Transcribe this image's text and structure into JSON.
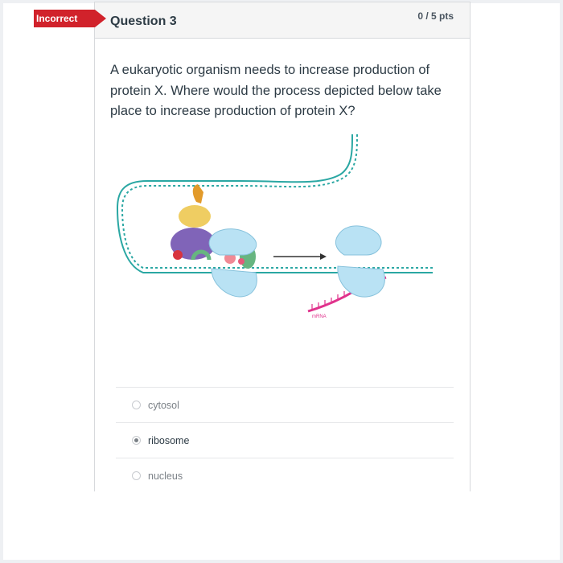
{
  "result_badge": {
    "label": "Incorrect",
    "color": "#d1222b"
  },
  "question": {
    "title": "Question 3",
    "points": "0 / 5 pts",
    "text": "A eukaryotic organism needs to increase production of protein X. Where would the process depicted below take place to increase production of protein X?"
  },
  "figure": {
    "mrna_label": "mRNA",
    "colors": {
      "dna": "#2aa7a3",
      "ribosome": "#b9e2f4",
      "mrna": "#e0328c",
      "polymerase_purple": "#8064b8",
      "factor_yellow": "#efcd62",
      "factor_orange": "#e29a2a",
      "factor_green": "#67b580"
    }
  },
  "answers": [
    {
      "label": "cytosol",
      "selected": false
    },
    {
      "label": "ribosome",
      "selected": true
    },
    {
      "label": "nucleus",
      "selected": false
    }
  ]
}
